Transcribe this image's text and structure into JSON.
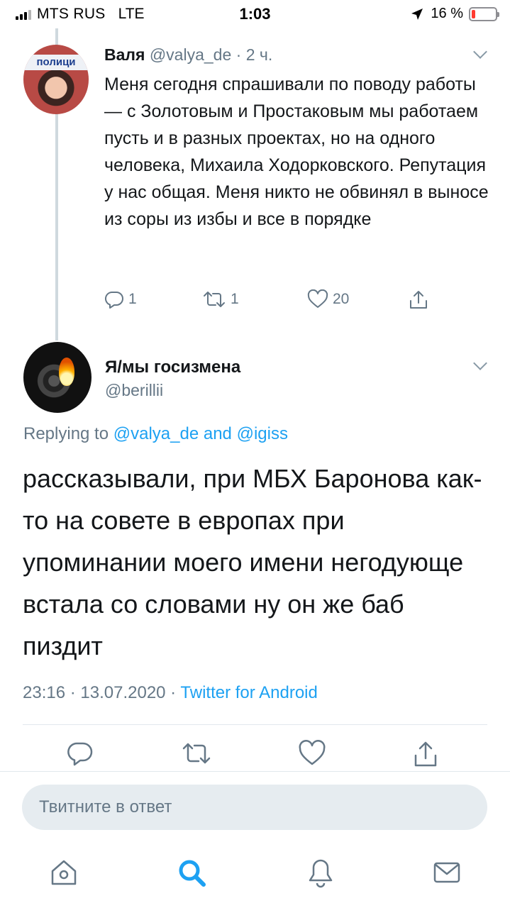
{
  "status_bar": {
    "carrier": "MTS RUS",
    "network": "LTE",
    "time": "1:03",
    "battery_percent": "16 %",
    "battery_level": 0.16,
    "battery_color": "#ff3b30"
  },
  "tweet_parent": {
    "name": "Валя",
    "handle": "@valya_de",
    "separator": " · ",
    "time_ago": "2 ч.",
    "avatar_banner": "полици",
    "text": "Меня сегодня спрашивали по поводу работы — с Золотовым и Простаковым мы работаем пусть и в разных проектах, но на одного человека, Михаила Ходорковского. Репутация у нас общая. Меня никто не обвинял в выносе из соры из избы и все в порядке",
    "replies": "1",
    "retweets": "1",
    "likes": "20",
    "icons": [
      "reply-icon",
      "retweet-icon",
      "like-icon",
      "share-icon",
      "chevron-down-icon"
    ]
  },
  "tweet_main": {
    "name": "Я/мы госизмена",
    "handle": "@berillii",
    "replying_prefix": "Replying to ",
    "mention1": "@valya_de",
    "replying_and": " and ",
    "mention2": "@igiss",
    "text": "рассказывали, при МБХ Баронова как-то на совете в европах при упоминании моего имени негодующе встала со словами ну он же баб пиздит",
    "time": "23:16",
    "date": "13.07.2020",
    "meta_sep": " · ",
    "source": "Twitter for Android",
    "icons": [
      "reply-icon",
      "retweet-icon",
      "like-icon",
      "share-icon"
    ]
  },
  "reply_box": {
    "placeholder": "Твитните в ответ"
  },
  "tab_bar": {
    "icons": [
      "home-icon",
      "search-icon",
      "notifications-icon",
      "messages-icon"
    ],
    "active": "search-icon"
  },
  "colors": {
    "accent": "#1da1f2",
    "secondary_text": "#657786",
    "primary_text": "#14171a",
    "reply_box_bg": "#e6ecf0"
  }
}
